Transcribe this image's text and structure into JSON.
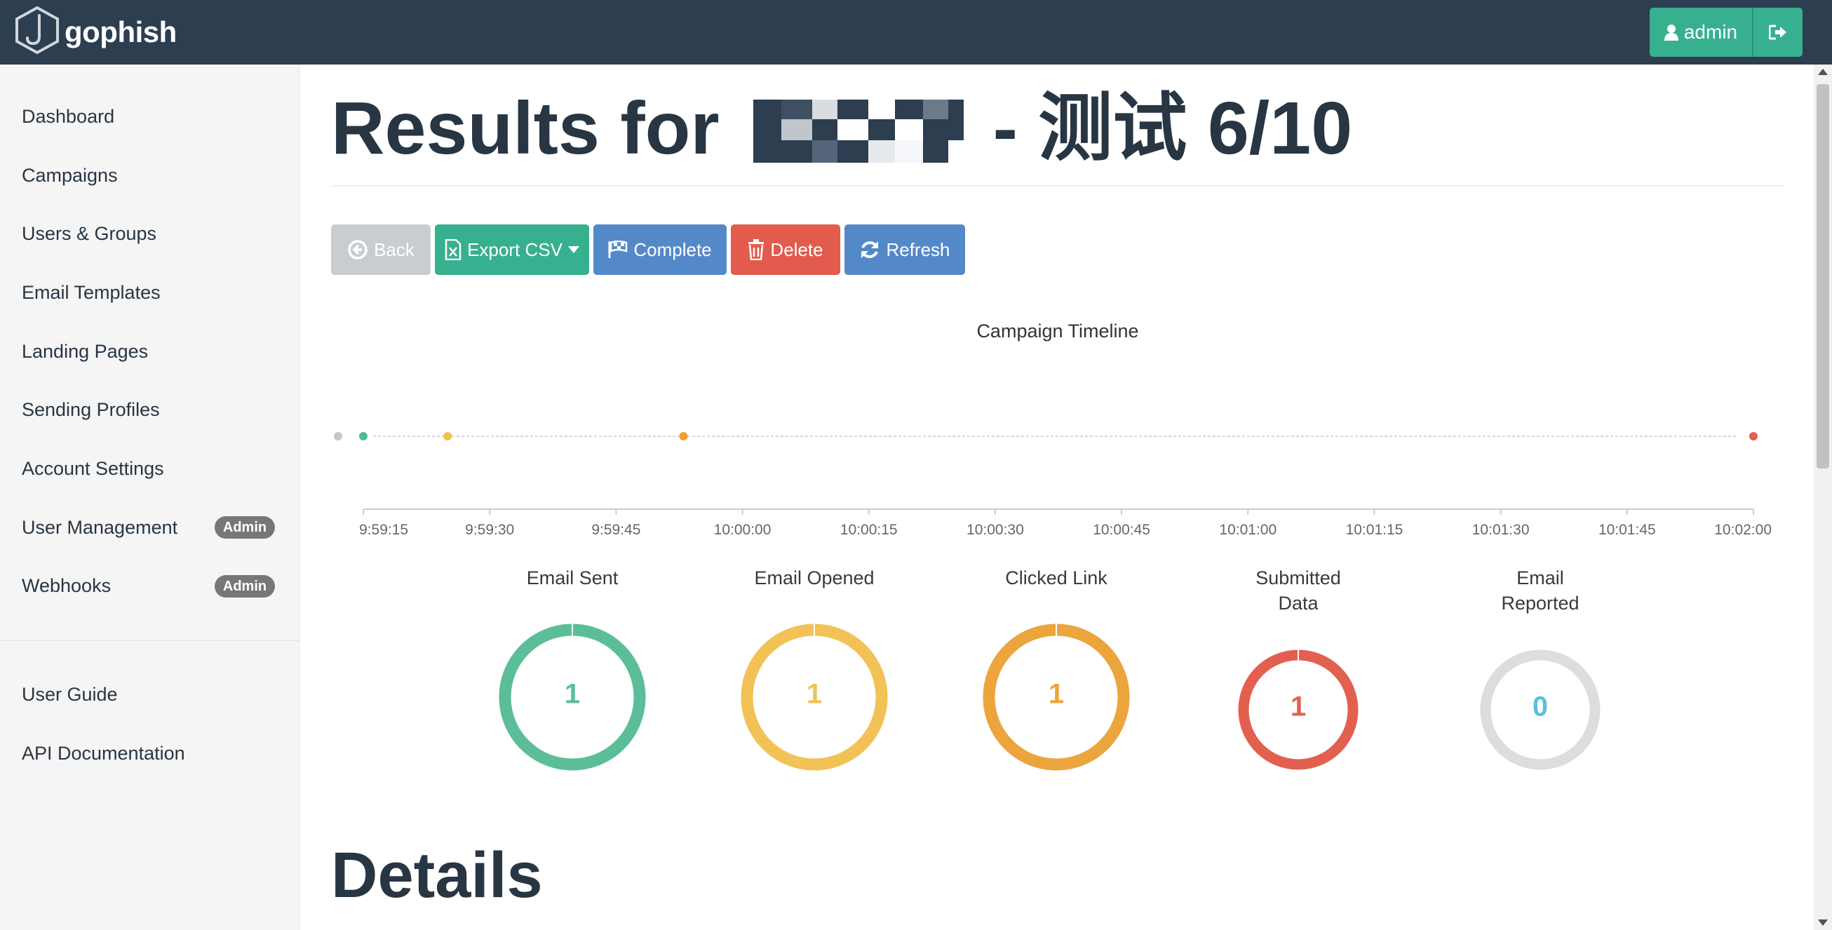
{
  "brand": {
    "name": "gophish"
  },
  "topbar": {
    "user_label": "admin",
    "logout_icon": "sign-out-icon",
    "user_icon": "user-icon"
  },
  "sidebar": {
    "items": [
      {
        "label": "Dashboard"
      },
      {
        "label": "Campaigns"
      },
      {
        "label": "Users & Groups"
      },
      {
        "label": "Email Templates"
      },
      {
        "label": "Landing Pages"
      },
      {
        "label": "Sending Profiles"
      },
      {
        "label": "Account Settings"
      },
      {
        "label": "User Management",
        "badge": "Admin"
      },
      {
        "label": "Webhooks",
        "badge": "Admin"
      }
    ],
    "footer_items": [
      {
        "label": "User Guide"
      },
      {
        "label": "API Documentation"
      }
    ]
  },
  "page": {
    "title_prefix": "Results for",
    "title_suffix": "- 测试 6/10",
    "details_heading": "Details"
  },
  "toolbar": {
    "back": "Back",
    "export": "Export CSV",
    "complete": "Complete",
    "delete": "Delete",
    "refresh": "Refresh"
  },
  "timeline": {
    "title": "Campaign Timeline",
    "ticks": [
      "9:59:15",
      "9:59:30",
      "9:59:45",
      "10:00:00",
      "10:00:15",
      "10:00:30",
      "10:00:45",
      "10:01:00",
      "10:01:15",
      "10:01:30",
      "10:01:45",
      "10:02:00"
    ]
  },
  "chart_data": {
    "type": "scatter",
    "title": "Campaign Timeline",
    "x_range": [
      "9:59:12",
      "10:02:03"
    ],
    "events": [
      {
        "time": "9:59:12",
        "color": "#c7c7c7"
      },
      {
        "time": "9:59:15",
        "color": "#4fbb96"
      },
      {
        "time": "9:59:25",
        "color": "#f0c14b"
      },
      {
        "time": "9:59:53",
        "color": "#f0a030"
      },
      {
        "time": "10:02:00",
        "color": "#e45d50"
      }
    ]
  },
  "stats": [
    {
      "label": "Email Sent",
      "value": "1",
      "color": "#5bbe98"
    },
    {
      "label": "Email Opened",
      "value": "1",
      "color": "#f2c257"
    },
    {
      "label": "Clicked Link",
      "value": "1",
      "color": "#eca43c"
    },
    {
      "label": "Submitted Data",
      "value": "1",
      "color": "#e36050"
    },
    {
      "label": "Email Reported",
      "value": "0",
      "color": "#5bc0de"
    }
  ],
  "colors": {
    "navbar": "#2c3e50",
    "primary_green": "#37b08f",
    "blue": "#5489c9",
    "red": "#e25b4d",
    "grey": "#c7cdd1"
  }
}
